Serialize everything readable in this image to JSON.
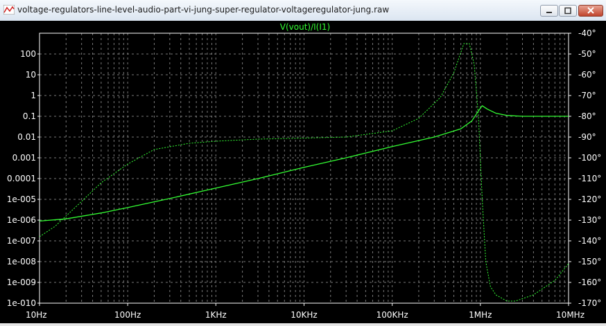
{
  "window": {
    "title": "voltage-regulators-line-level-audio-part-vi-jung-super-regulator-voltageregulator-jung.raw",
    "icon": "waveform-icon",
    "buttons": [
      "minimize-icon",
      "maximize-icon",
      "close-icon"
    ]
  },
  "colors": {
    "background": "#000000",
    "trace": "#33ff33",
    "grid": "#7a7a7a",
    "labels": "#ffffff"
  },
  "chart_data": {
    "type": "line",
    "title": "V(vout)/I(I1)",
    "x_scale": "log",
    "xlim": [
      10,
      10000000
    ],
    "x_tick_labels": [
      "10Hz",
      "100Hz",
      "1KHz",
      "10KHz",
      "100KHz",
      "1MHz",
      "10MHz"
    ],
    "x_tick_values": [
      10,
      100,
      1000,
      10000,
      100000,
      1000000,
      10000000
    ],
    "y_scale": "log",
    "ylim": [
      1e-10,
      1000
    ],
    "y_tick_labels": [
      "100",
      "10",
      "1",
      "0.1",
      "0.01",
      "0.001",
      "0.0001",
      "1e-005",
      "1e-006",
      "1e-007",
      "1e-008",
      "1e-009",
      "1e-010"
    ],
    "y_tick_values": [
      100,
      10,
      1,
      0.1,
      0.01,
      0.001,
      0.0001,
      1e-05,
      1e-06,
      1e-07,
      1e-08,
      1e-09,
      1e-10
    ],
    "y2lim": [
      -170,
      -40
    ],
    "y2_tick_labels": [
      "-40°",
      "-50°",
      "-60°",
      "-70°",
      "-80°",
      "-90°",
      "-100°",
      "-110°",
      "-120°",
      "-130°",
      "-140°",
      "-150°",
      "-160°",
      "-170°"
    ],
    "y2_tick_values": [
      -40,
      -50,
      -60,
      -70,
      -80,
      -90,
      -100,
      -110,
      -120,
      -130,
      -140,
      -150,
      -160,
      -170
    ],
    "grid": true,
    "series": [
      {
        "kind": "magnitude",
        "style": "solid",
        "x": [
          10,
          20,
          50,
          100,
          300,
          1000,
          3000,
          10000,
          30000,
          100000,
          300000,
          600000,
          800000,
          950000,
          1050000,
          1200000,
          1500000,
          2000000,
          3000000,
          5000000,
          10000000
        ],
        "y": [
          9e-07,
          1.15e-06,
          2.2e-06,
          4e-06,
          1.1e-05,
          3.5e-05,
          0.0001,
          0.00035,
          0.001,
          0.0035,
          0.01,
          0.025,
          0.06,
          0.18,
          0.32,
          0.22,
          0.14,
          0.11,
          0.1,
          0.1,
          0.1
        ]
      },
      {
        "kind": "phase",
        "style": "dashed",
        "x": [
          10,
          15,
          20,
          30,
          50,
          100,
          200,
          500,
          1000,
          3000,
          10000,
          30000,
          100000,
          200000,
          350000,
          500000,
          650000,
          750000,
          850000,
          950000,
          1050000,
          1150000,
          1300000,
          1500000,
          2000000,
          2500000,
          4000000,
          7000000,
          10000000
        ],
        "y": [
          -138,
          -133,
          -128,
          -121,
          -112,
          -103,
          -96,
          -93,
          -92,
          -91,
          -90.5,
          -90,
          -87,
          -81,
          -71,
          -59,
          -45,
          -45,
          -55,
          -80,
          -120,
          -150,
          -162,
          -166,
          -169,
          -169,
          -166,
          -159,
          -151
        ]
      }
    ]
  }
}
